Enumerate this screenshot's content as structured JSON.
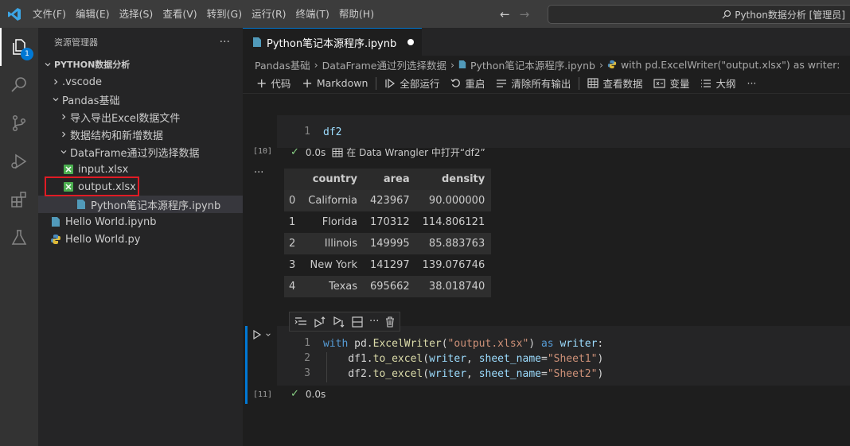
{
  "titlebar": {
    "menu": [
      "文件(F)",
      "编辑(E)",
      "选择(S)",
      "查看(V)",
      "转到(G)",
      "运行(R)",
      "终端(T)",
      "帮助(H)"
    ],
    "search_text": "Python数据分析 [管理员]"
  },
  "activity": {
    "badge_count": "1"
  },
  "sidebar": {
    "header": "资源管理器",
    "more": "···",
    "root": "PYTHON数据分析",
    "tree": [
      {
        "label": ".vscode",
        "type": "folder-closed",
        "indent": 1
      },
      {
        "label": "Pandas基础",
        "type": "folder-open",
        "indent": 1
      },
      {
        "label": "导入导出Excel数据文件",
        "type": "folder-closed",
        "indent": 2
      },
      {
        "label": "数据结构和新增数据",
        "type": "folder-closed",
        "indent": 2
      },
      {
        "label": "DataFrame通过列选择数据",
        "type": "folder-open",
        "indent": 2
      },
      {
        "label": "input.xlsx",
        "type": "excel",
        "indent": 3
      },
      {
        "label": "output.xlsx",
        "type": "excel",
        "indent": 3
      },
      {
        "label": "Python笔记本源程序.ipynb",
        "type": "notebook",
        "indent": 3
      },
      {
        "label": "Hello World.ipynb",
        "type": "notebook",
        "indent": 1
      },
      {
        "label": "Hello World.py",
        "type": "python",
        "indent": 1
      }
    ]
  },
  "editor": {
    "tab_label": "Python笔记本源程序.ipynb",
    "breadcrumb": [
      "Pandas基础",
      "DataFrame通过列选择数据",
      "Python笔记本源程序.ipynb",
      "with pd.ExcelWriter(\"output.xlsx\") as writer:"
    ],
    "toolbar": {
      "code": "代码",
      "markdown": "Markdown",
      "run_all": "全部运行",
      "restart": "重启",
      "clear_outputs": "清除所有输出",
      "view_data": "查看数据",
      "variables": "变量",
      "outline": "大纲",
      "more": "···"
    }
  },
  "cell1": {
    "exec_count": "[10]",
    "line_number": "1",
    "code": "df2",
    "time": "0.0s",
    "wrangler_text": "在 Data Wrangler 中打开“df2”",
    "output_menu": "···",
    "table": {
      "columns": [
        "",
        "country",
        "area",
        "density"
      ],
      "rows": [
        [
          "0",
          "California",
          "423967",
          "90.000000"
        ],
        [
          "1",
          "Florida",
          "170312",
          "114.806121"
        ],
        [
          "2",
          "Illinois",
          "149995",
          "85.883763"
        ],
        [
          "3",
          "New York",
          "141297",
          "139.076746"
        ],
        [
          "4",
          "Texas",
          "695662",
          "38.018740"
        ]
      ]
    }
  },
  "cell2": {
    "exec_count": "[11]",
    "time": "0.0s",
    "lines": [
      {
        "n": "1",
        "tokens": [
          [
            "kw",
            "with"
          ],
          [
            "plain",
            " pd."
          ],
          [
            "fn",
            "ExcelWriter"
          ],
          [
            "plain",
            "("
          ],
          [
            "str",
            "\"output.xlsx\""
          ],
          [
            "plain",
            ") "
          ],
          [
            "kw",
            "as"
          ],
          [
            "plain",
            " "
          ],
          [
            "var",
            "writer"
          ],
          [
            "plain",
            ":"
          ]
        ]
      },
      {
        "n": "2",
        "tokens": [
          [
            "plain",
            "    df1."
          ],
          [
            "fn",
            "to_excel"
          ],
          [
            "plain",
            "("
          ],
          [
            "var",
            "writer"
          ],
          [
            "plain",
            ", "
          ],
          [
            "var",
            "sheet_name"
          ],
          [
            "plain",
            "="
          ],
          [
            "str",
            "\"Sheet1\""
          ],
          [
            "plain",
            ")"
          ]
        ]
      },
      {
        "n": "3",
        "tokens": [
          [
            "plain",
            "    df2."
          ],
          [
            "fn",
            "to_excel"
          ],
          [
            "plain",
            "("
          ],
          [
            "var",
            "writer"
          ],
          [
            "plain",
            ", "
          ],
          [
            "var",
            "sheet_name"
          ],
          [
            "plain",
            "="
          ],
          [
            "str",
            "\"Sheet2\""
          ],
          [
            "plain",
            ")"
          ]
        ]
      }
    ]
  },
  "colors": {
    "accent": "#0078d4",
    "highlight": "#e01b24",
    "excel": "#4caf50",
    "python": "#4b8bbe"
  }
}
